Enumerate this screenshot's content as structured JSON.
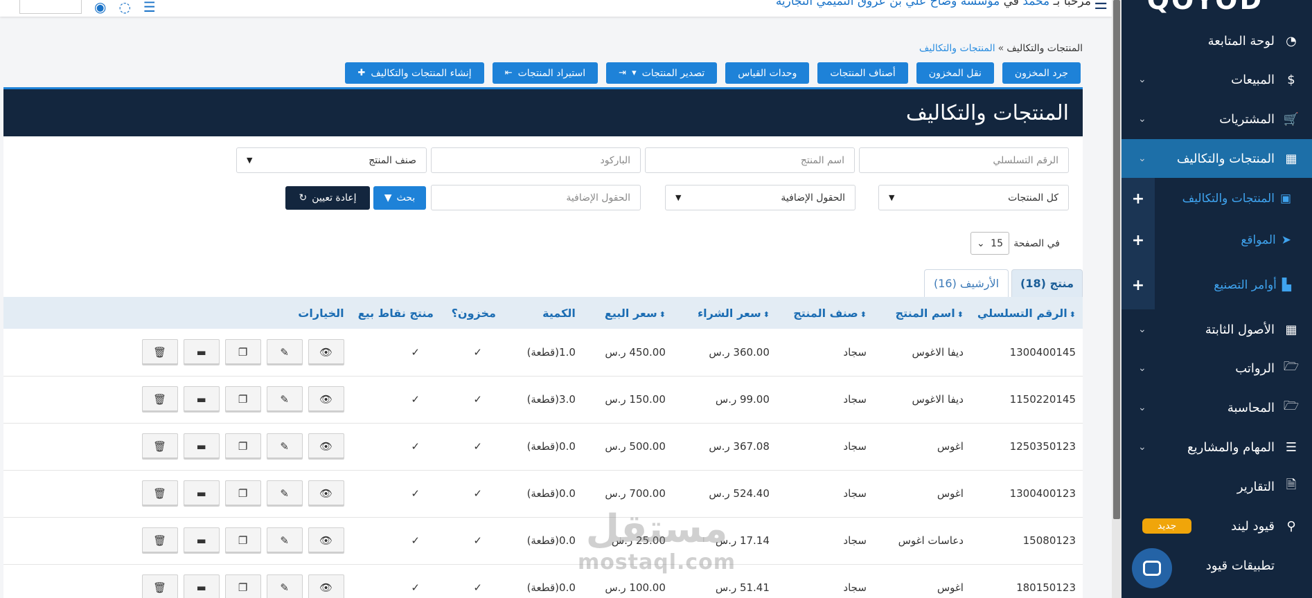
{
  "topbar": {
    "greeting_prefix": "مرحبا بـ",
    "greeting_name": "محمد",
    "greeting_in": "في",
    "company": "مؤسسة وضاح علي بن عروق التميمي التجارية"
  },
  "sidebar": {
    "logo": "QOYOD",
    "items": [
      {
        "label": "لوحة المتابعة",
        "icon": "dashboard-icon",
        "glyph": "◔"
      },
      {
        "label": "المبيعات",
        "icon": "dollar-icon",
        "glyph": "$"
      },
      {
        "label": "المشتريات",
        "icon": "cart-icon",
        "glyph": "🛒"
      },
      {
        "label": "المنتجات والتكاليف",
        "icon": "grid-icon",
        "glyph": "▦"
      },
      {
        "label": "الأصول الثابتة",
        "icon": "grid-icon",
        "glyph": "▦"
      },
      {
        "label": "الرواتب",
        "icon": "folder-icon",
        "glyph": "🗁"
      },
      {
        "label": "المحاسبة",
        "icon": "folder-icon",
        "glyph": "🗁"
      },
      {
        "label": "المهام والمشاريع",
        "icon": "list-icon",
        "glyph": "☰"
      },
      {
        "label": "التقارير",
        "icon": "file-icon",
        "glyph": "🗎"
      },
      {
        "label": "قيود ليند",
        "icon": "search-icon",
        "glyph": "⚲",
        "badge": "جديد"
      },
      {
        "label": "تطبيقات قيود",
        "icon": "apps-icon",
        "glyph": ""
      }
    ],
    "subitems": [
      {
        "label": "المنتجات والتكاليف",
        "icon": "box-icon",
        "glyph": "▣"
      },
      {
        "label": "المواقع",
        "icon": "location-arrow-icon",
        "glyph": "➤"
      },
      {
        "label": "أوامر التصنيع",
        "icon": "factory-icon",
        "glyph": "▙"
      }
    ]
  },
  "breadcrumb": {
    "current": "المنتجات والتكاليف",
    "sep": "»",
    "link": "المنتجات والتكاليف"
  },
  "toolbar": {
    "stocktake": "جرد المخزون",
    "transfer": "نقل المخزون",
    "categories": "أصناف المنتجات",
    "units": "وحدات القياس",
    "export": "تصدير المنتجات",
    "import": "استيراد المنتجات",
    "create": "إنشاء المنتجات والتكاليف"
  },
  "panel": {
    "title": "المنتجات والتكاليف"
  },
  "filters": {
    "serial_placeholder": "الرقم التسلسلي",
    "name_placeholder": "اسم المنتج",
    "barcode_placeholder": "الباركود",
    "category_select": "صنف المنتج",
    "all_products_select": "كل المنتجات",
    "extra_fields_select": "الحقول الإضافية",
    "extra_fields_placeholder": "الحقول الإضافية",
    "search_label": "بحث",
    "reset_label": "إعادة تعيين"
  },
  "pagination": {
    "per_page_label": "في الصفحة",
    "per_page_value": "15"
  },
  "tabs": {
    "products": "منتج (18)",
    "archive": "الأرشيف (16)"
  },
  "table": {
    "headers": [
      "الرقم التسلسلي",
      "اسم المنتج",
      "صنف المنتج",
      "سعر الشراء",
      "سعر البيع",
      "الكمية",
      "مخزون؟",
      "منتج نقاط بيع",
      "الخيارات"
    ],
    "rows": [
      {
        "serial": "1300400145",
        "name": "ديفا الاغوس",
        "category": "سجاد",
        "buy": "360.00 ر.س",
        "sell": "450.00 ر.س",
        "qty": "1.0(قطعة)",
        "stock": "✓",
        "pos": "✓"
      },
      {
        "serial": "1150220145",
        "name": "ديفا الاغوس",
        "category": "سجاد",
        "buy": "99.00 ر.س",
        "sell": "150.00 ر.س",
        "qty": "3.0(قطعة)",
        "stock": "✓",
        "pos": "✓"
      },
      {
        "serial": "1250350123",
        "name": "اغوس",
        "category": "سجاد",
        "buy": "367.08 ر.س",
        "sell": "500.00 ر.س",
        "qty": "0.0(قطعة)",
        "stock": "✓",
        "pos": "✓"
      },
      {
        "serial": "1300400123",
        "name": "اغوس",
        "category": "سجاد",
        "buy": "524.40 ر.س",
        "sell": "700.00 ر.س",
        "qty": "0.0(قطعة)",
        "stock": "✓",
        "pos": "✓"
      },
      {
        "serial": "15080123",
        "name": "دعاسات اغوس",
        "category": "سجاد",
        "buy": "17.14 ر.س",
        "sell": "25.00 ر.س",
        "qty": "0.0(قطعة)",
        "stock": "✓",
        "pos": "✓"
      },
      {
        "serial": "180150123",
        "name": "اغوس",
        "category": "سجاد",
        "buy": "51.41 ر.س",
        "sell": "100.00 ر.س",
        "qty": "0.0(قطعة)",
        "stock": "✓",
        "pos": "✓"
      }
    ]
  },
  "watermark": {
    "arabic": "مستقل",
    "latin": "mostaql.com"
  },
  "colors": {
    "primary": "#1e82d8",
    "navy": "#13263e",
    "active_nav": "#1d6fa8",
    "badge": "#f0a50a"
  }
}
